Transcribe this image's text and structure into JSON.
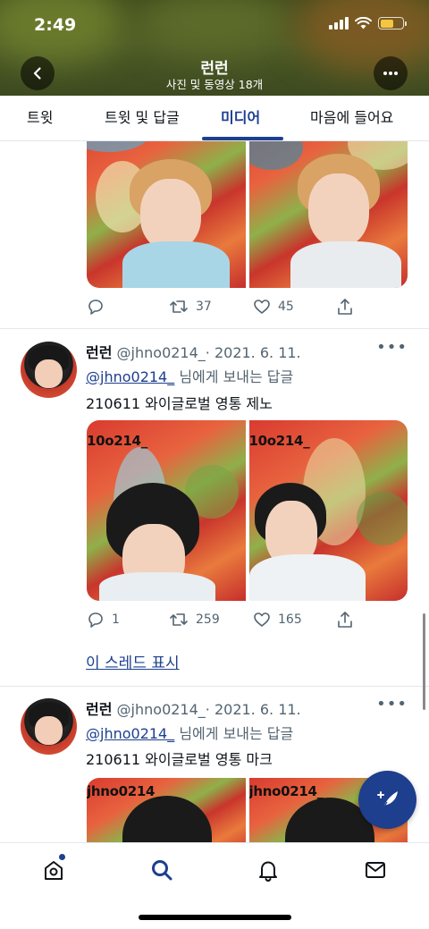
{
  "status_bar": {
    "time": "2:49"
  },
  "header": {
    "title": "런런",
    "subtitle": "사진 및 동영상 18개"
  },
  "tabs": [
    {
      "label": "트윗"
    },
    {
      "label": "트윗 및 답글"
    },
    {
      "label": "미디어"
    },
    {
      "label": "마음에 들어요"
    }
  ],
  "active_tab": "미디어",
  "tweets": [
    {
      "actions": {
        "reply": "",
        "retweet": "37",
        "like": "45"
      }
    },
    {
      "name": "런런",
      "handle": "@jhno0214_",
      "date": "· 2021. 6. 11.",
      "reply_to_mention": "@jhno0214_",
      "reply_to_suffix": " 님에게 보내는 답글",
      "text": "210611 와이글로벌 영통 제노",
      "media_watermarks": [
        "10o214_",
        "10o214_"
      ],
      "actions": {
        "reply": "1",
        "retweet": "259",
        "like": "165"
      },
      "thread_link": "이 스레드 표시"
    },
    {
      "name": "런런",
      "handle": "@jhno0214_",
      "date": "· 2021. 6. 11.",
      "reply_to_mention": "@jhno0214_",
      "reply_to_suffix": " 님에게 보내는 답글",
      "text": "210611 와이글로벌 영통 마크",
      "media_watermarks": [
        "jhno0214_",
        "jhno0214_"
      ]
    }
  ],
  "colors": {
    "accent": "#1d3f8f",
    "fab": "#1e3e8e",
    "muted": "#536471"
  },
  "icons": {
    "back": "back-arrow-icon",
    "more": "more-icon",
    "reply": "reply-icon",
    "retweet": "retweet-icon",
    "like": "heart-icon",
    "share": "share-icon",
    "compose": "compose-feather-icon",
    "nav": [
      "home-icon",
      "search-icon",
      "notifications-icon",
      "messages-icon"
    ]
  }
}
